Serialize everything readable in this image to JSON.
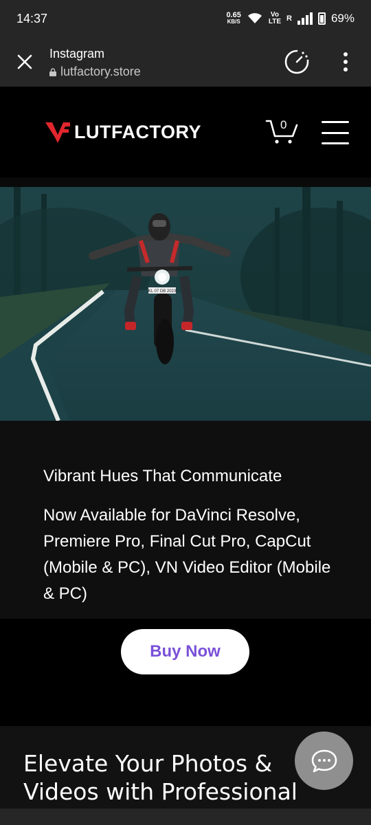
{
  "status_bar": {
    "time": "14:37",
    "net_speed": "0.65",
    "net_speed_unit": "KB/S",
    "volte_top": "Vo",
    "volte_bottom": "LTE",
    "roaming": "R",
    "battery": "69%"
  },
  "browser": {
    "title": "Instagram",
    "url": "lutfactory.store"
  },
  "header": {
    "logo_text": "LUTFACTORY",
    "cart_count": "0"
  },
  "hero": {
    "plate_text": "KL 07 DB 2023"
  },
  "content": {
    "headline": "Vibrant Hues That Communicate",
    "availability": "Now Available for DaVinci Resolve, Premiere Pro, Final Cut Pro, CapCut (Mobile & PC), VN Video Editor (Mobile & PC)",
    "buy_button": "Buy Now",
    "feature_title": "Elevate Your Photos & Videos with Professional"
  },
  "colors": {
    "brand_red": "#e1262d",
    "buy_text": "#7a50d8",
    "chat_bg": "#8f8f8f"
  }
}
